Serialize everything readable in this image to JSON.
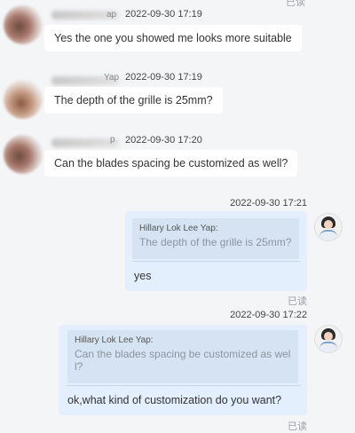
{
  "top_read_status": "已读",
  "incoming": [
    {
      "timestamp": "2022-09-30 17:19",
      "name_suffix": "ap",
      "text": "Yes the one you showed me looks more suitable"
    },
    {
      "timestamp": "2022-09-30 17:19",
      "name_suffix": "Yap",
      "text": "The depth of the grille is 25mm?"
    },
    {
      "timestamp": "2022-09-30 17:20",
      "name_suffix": "p",
      "text": "Can the blades spacing be customized as well?"
    }
  ],
  "outgoing": [
    {
      "timestamp": "2022-09-30 17:21",
      "quote_author": "Hillary Lok Lee Yap:",
      "quote_text": "The depth of the grille is 25mm?",
      "reply": "yes",
      "read_status": "已读"
    },
    {
      "timestamp": "2022-09-30 17:22",
      "quote_author": "Hillary Lok Lee Yap:",
      "quote_line1": "Can the blades spacing be customized as wel",
      "quote_line2": "l?",
      "reply": "ok,what kind of customization do you want?",
      "read_status": "已读"
    }
  ]
}
